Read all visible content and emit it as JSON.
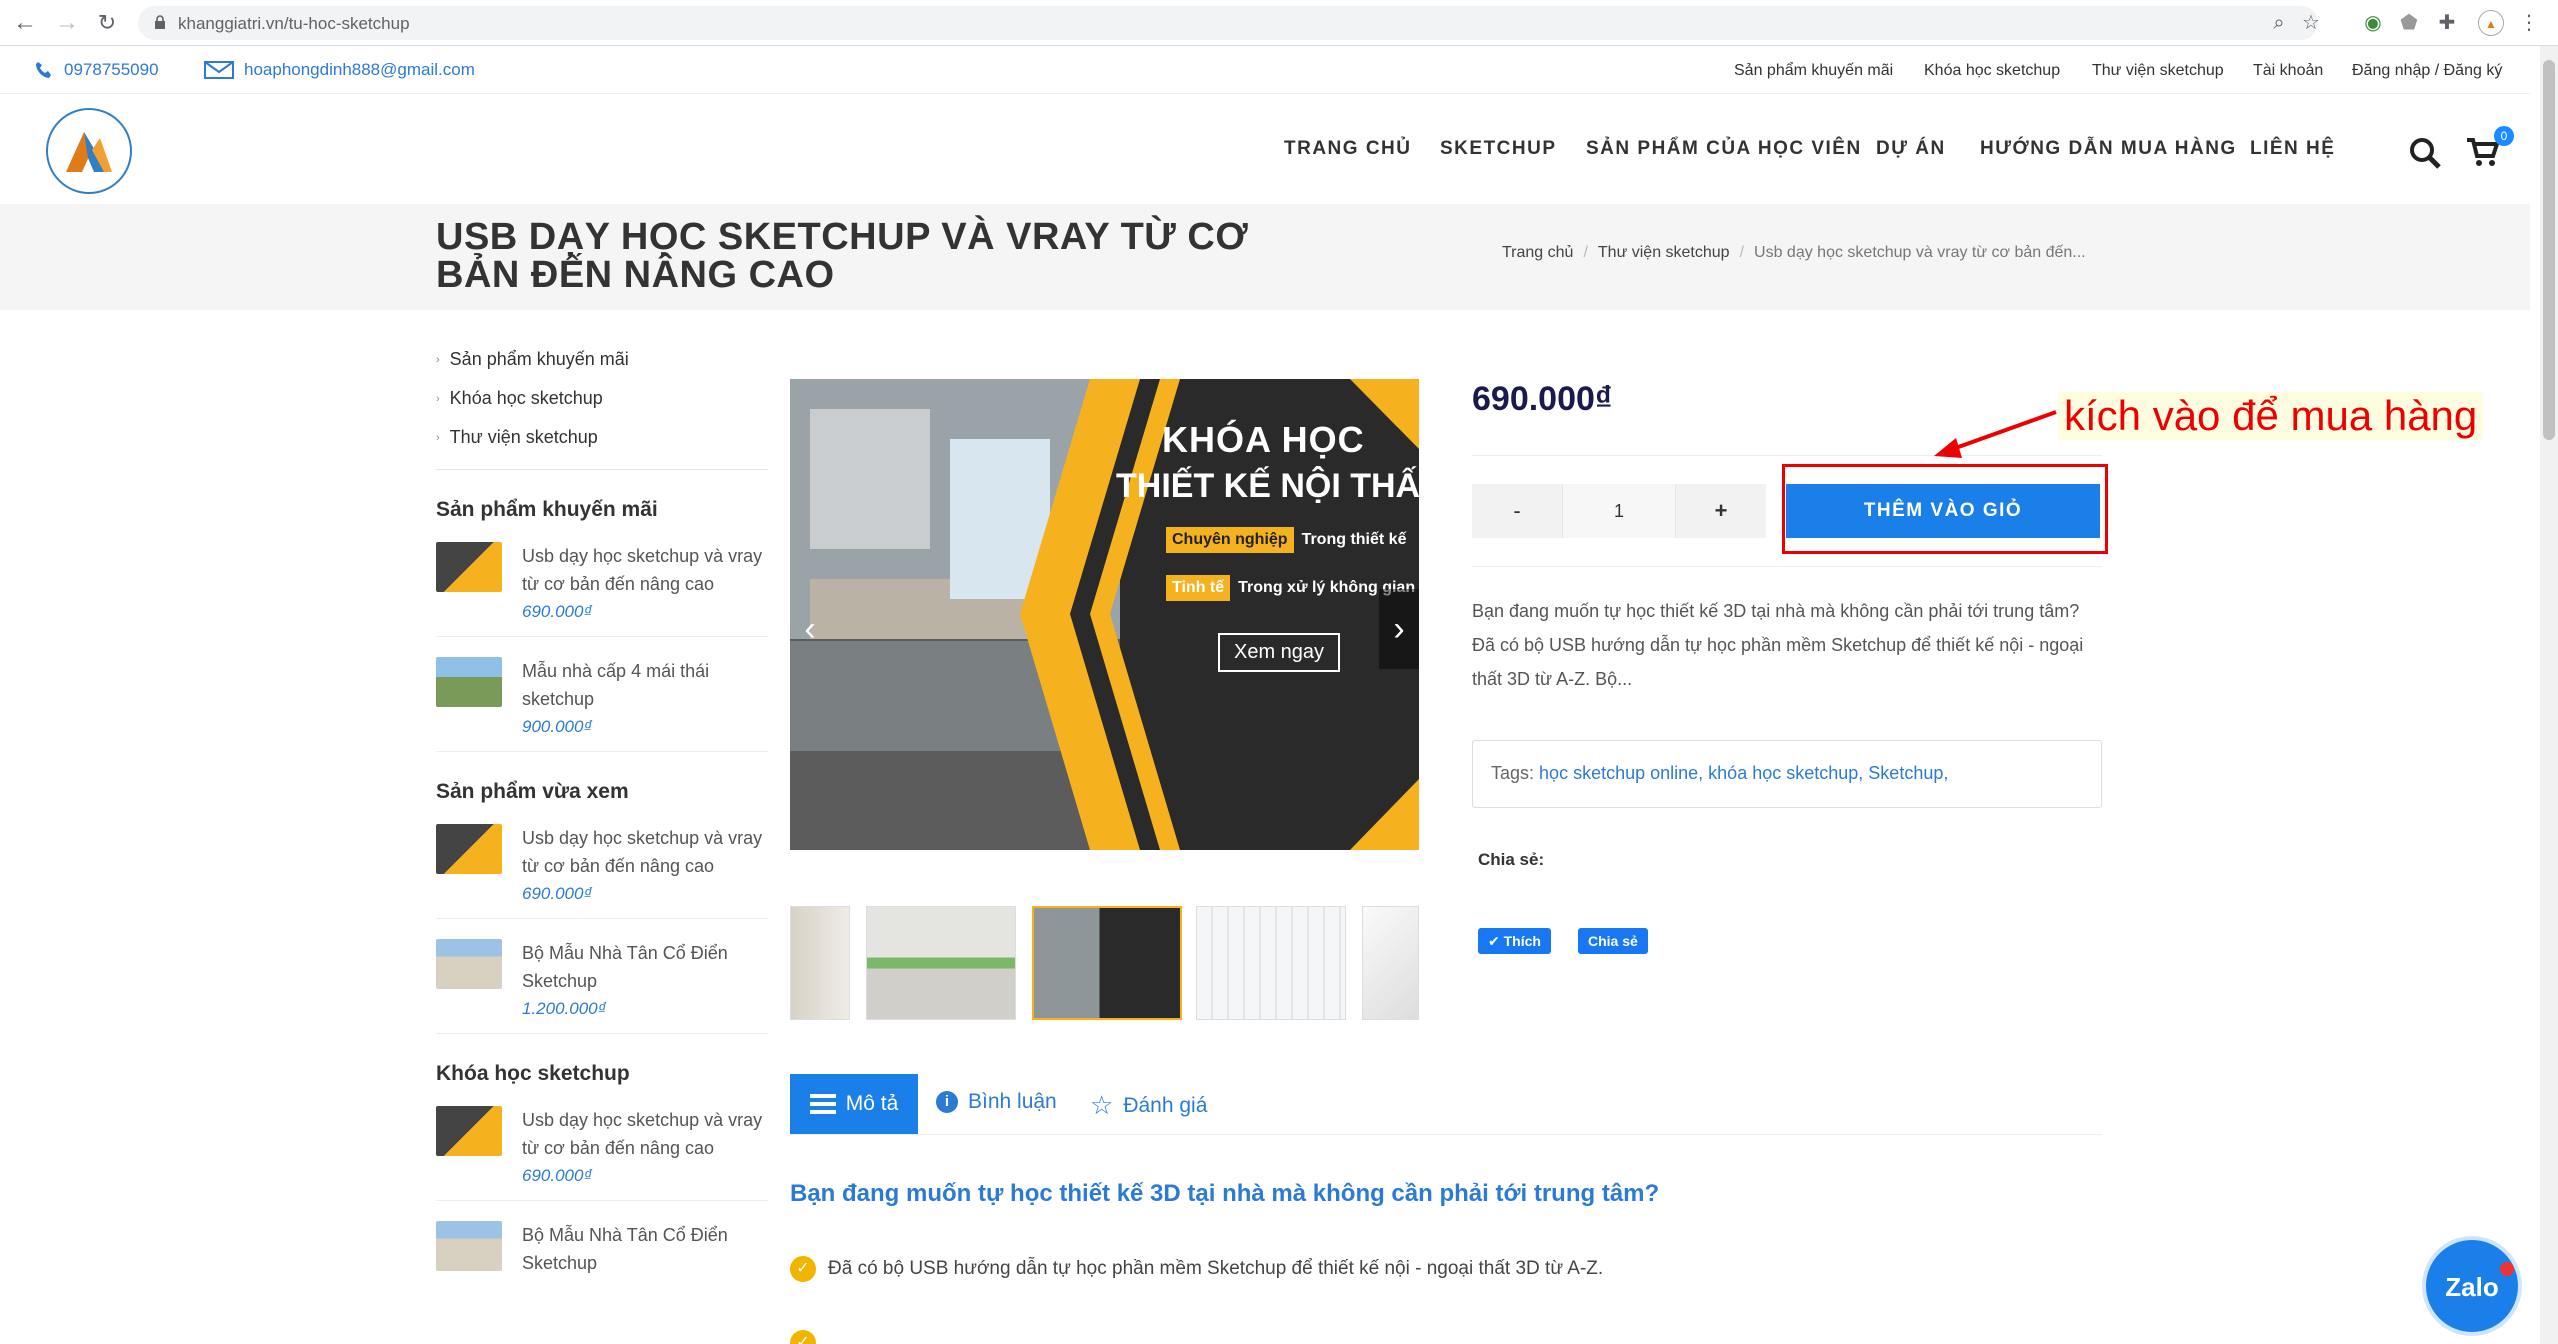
{
  "browser": {
    "url": "khanggiatri.vn/tu-hoc-sketchup"
  },
  "topbar": {
    "phone": "0978755090",
    "email": "hoaphongdinh888@gmail.com",
    "links": [
      "Sản phẩm khuyến mãi",
      "Khóa học sketchup",
      "Thư viện sketchup",
      "Tài khoản",
      "Đăng nhập / Đăng ký"
    ]
  },
  "menu": [
    "TRANG CHỦ",
    "SKETCHUP",
    "SẢN PHẨM CỦA HỌC VIÊN",
    "DỰ ÁN",
    "HƯỚNG DẪN MUA HÀNG",
    "LIÊN HỆ"
  ],
  "cart_count": "0",
  "page_title": "USB DẠY HỌC SKETCHUP VÀ VRAY TỪ CƠ BẢN ĐẾN NÂNG CAO",
  "breadcrumb": [
    "Trang chủ",
    "Thư viện sketchup",
    "Usb dạy học sketchup và vray từ cơ bản đến..."
  ],
  "sidebar": {
    "categories": [
      "Sản phẩm khuyến mãi",
      "Khóa học sketchup",
      "Thư viện sketchup"
    ],
    "sections": [
      {
        "title": "Sản phẩm khuyến mãi",
        "items": [
          {
            "name": "Usb dạy học sketchup và vray từ cơ bản đến nâng cao",
            "price": "690.000₫"
          },
          {
            "name": "Mẫu nhà cấp 4 mái thái sketchup",
            "price": "900.000₫"
          }
        ]
      },
      {
        "title": "Sản phẩm vừa xem",
        "items": [
          {
            "name": "Usb dạy học sketchup và vray từ cơ bản đến nâng cao",
            "price": "690.000₫"
          },
          {
            "name": "Bộ Mẫu Nhà Tân Cổ Điển Sketchup",
            "price": "1.200.000₫"
          }
        ]
      },
      {
        "title": "Khóa học sketchup",
        "items": [
          {
            "name": "Usb dạy học sketchup và vray từ cơ bản đến nâng cao",
            "price": "690.000₫"
          },
          {
            "name": "Bộ Mẫu Nhà Tân Cổ Điển Sketchup",
            "price": ""
          }
        ]
      }
    ]
  },
  "banner": {
    "line1": "KHÓA HỌC",
    "line2": "THIẾT KẾ NỘI THẤT",
    "tag1": "Chuyên nghiệp",
    "tag1_text": "Trong thiết kế",
    "tag2": "Tinh tế",
    "tag2_text": "Trong xử lý không gian",
    "cta": "Xem ngay"
  },
  "product": {
    "price": "690.000₫",
    "qty_minus": "-",
    "qty_value": "1",
    "qty_plus": "+",
    "add_to_cart": "THÊM VÀO GIỎ",
    "annotation": "kích vào để mua hàng",
    "short_desc": "Bạn đang muốn tự học thiết kế 3D tại nhà mà không cần phải tới trung tâm? Đã có bộ USB hướng dẫn tự học phần mềm Sketchup để thiết kế nội - ngoại thất 3D từ A-Z. Bộ...",
    "tags_label": "Tags:",
    "tags": [
      "học sketchup online,",
      "khóa học sketchup,",
      "Sketchup,"
    ],
    "share_label": "Chia sẻ:",
    "like": "Thích",
    "share": "Chia sẻ"
  },
  "tabs": [
    "Mô tả",
    "Bình luận",
    "Đánh giá"
  ],
  "content": {
    "heading": "Bạn đang muốn tự học thiết kế 3D tại nhà mà không cần phải tới trung tâm?",
    "line1": "Đã có bộ USB hướng dẫn tự học phần mềm Sketchup để thiết kế nội - ngoại thất 3D từ A-Z."
  },
  "zalo": "Zalo",
  "colors": {
    "accent": "#1a7fe8",
    "link": "#2b7bd6",
    "annotation": "#ee0000",
    "banner_yellow": "#f5b21e"
  }
}
